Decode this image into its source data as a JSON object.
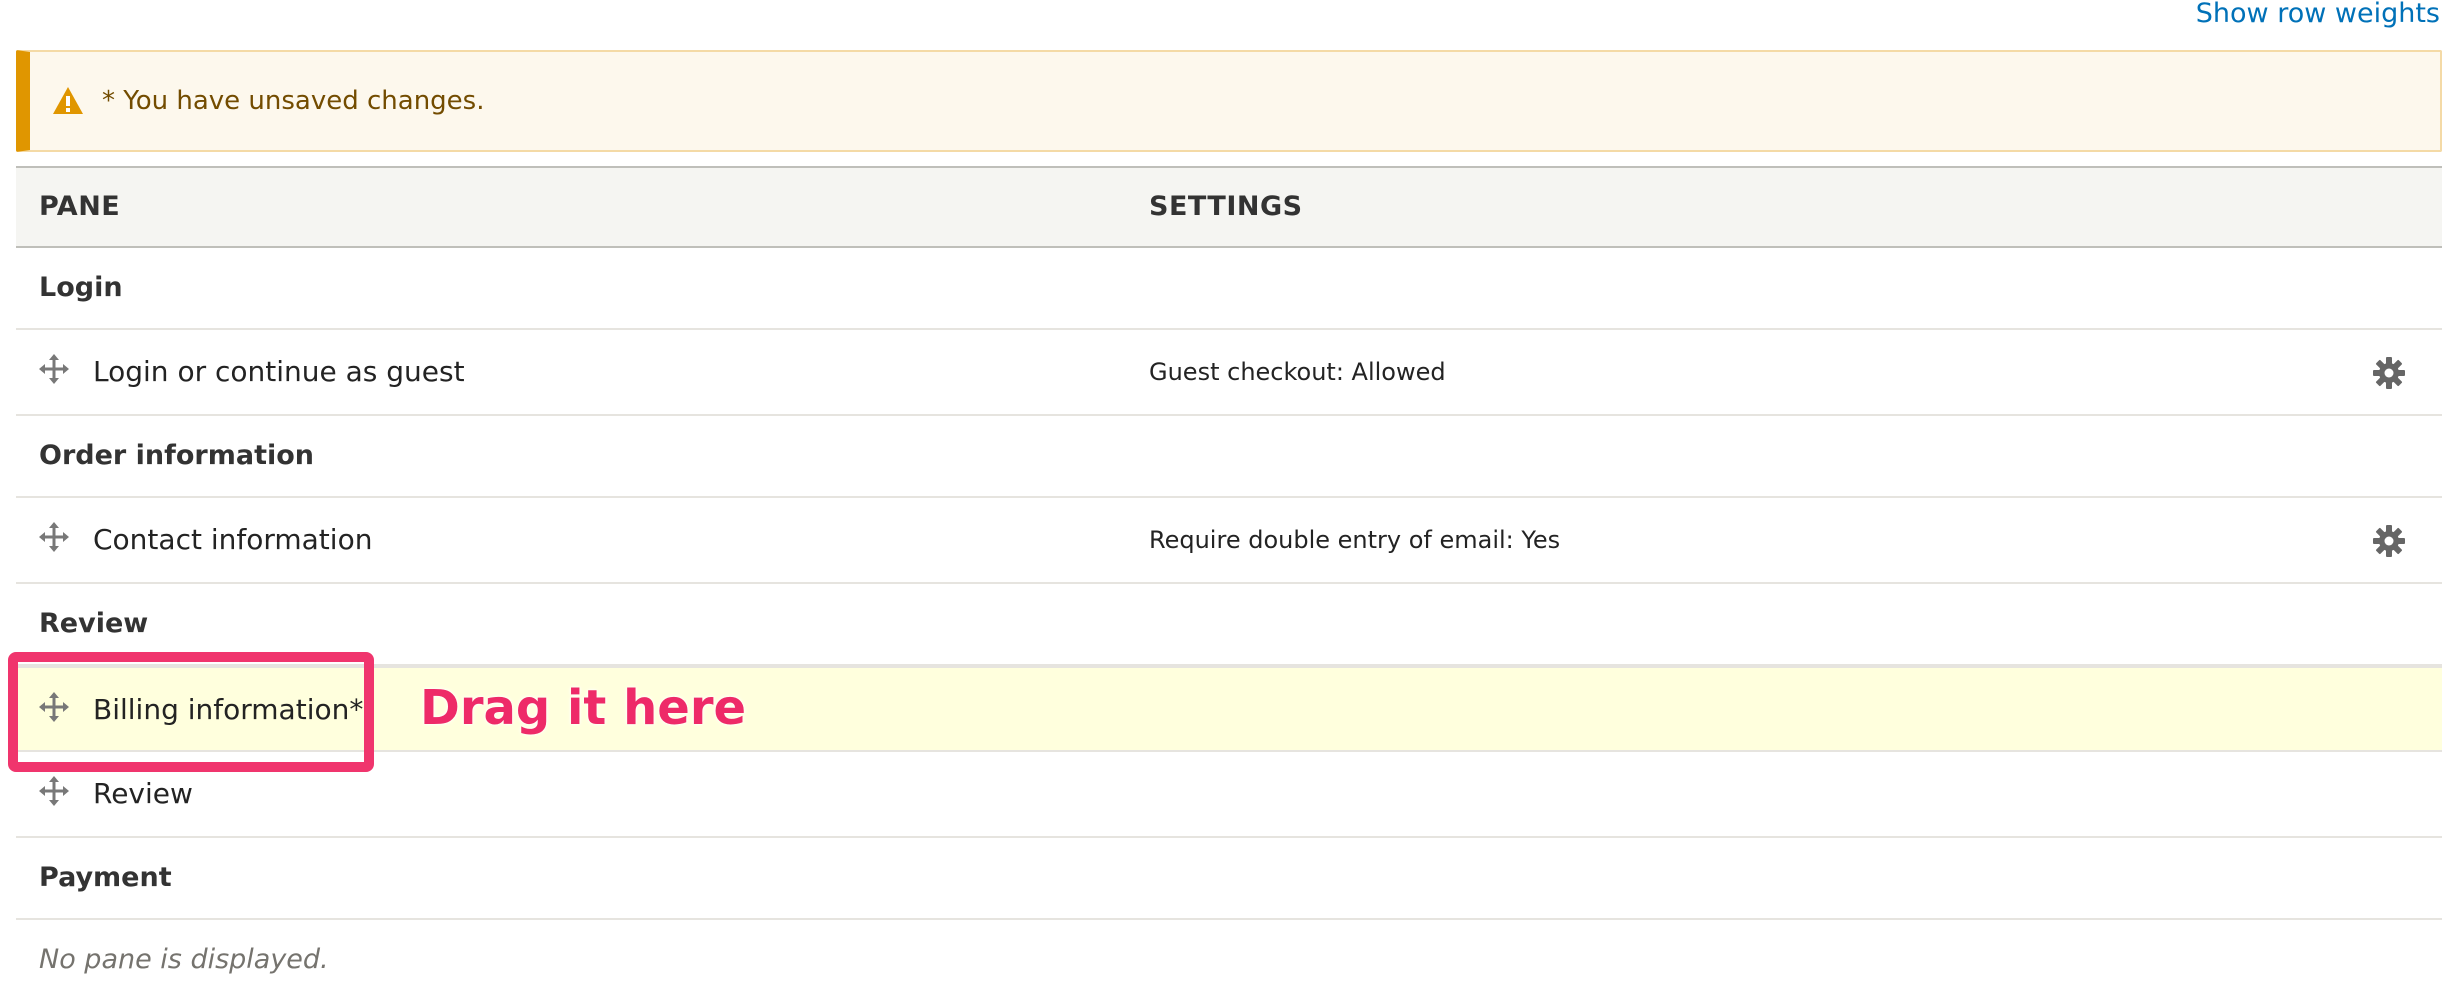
{
  "header": {
    "row_weights_link": "Show row weights"
  },
  "message": {
    "icon": "warning-icon",
    "text": "* You have unsaved changes."
  },
  "table": {
    "columns": [
      "PANE",
      "SETTINGS"
    ],
    "regions": [
      {
        "label": "Login",
        "panes": [
          {
            "label": "Login or continue as guest",
            "settings": "Guest checkout: Allowed",
            "has_settings_button": true
          }
        ]
      },
      {
        "label": "Order information",
        "panes": [
          {
            "label": "Contact information",
            "settings": "Require double entry of email: Yes",
            "has_settings_button": true
          }
        ]
      },
      {
        "label": "Review",
        "panes": [
          {
            "label": "Billing information*",
            "settings": "",
            "has_settings_button": false,
            "highlighted": true
          },
          {
            "label": "Review",
            "settings": "",
            "has_settings_button": false
          }
        ]
      },
      {
        "label": "Payment",
        "empty_text": "No pane is displayed."
      }
    ]
  },
  "annotation": {
    "text": "Drag it here",
    "color": "#ee2a68"
  },
  "colors": {
    "link": "#0071b8",
    "warning_accent": "#e09600",
    "warning_bg": "#fdf8ed",
    "highlight_bg": "#ffffdd"
  }
}
